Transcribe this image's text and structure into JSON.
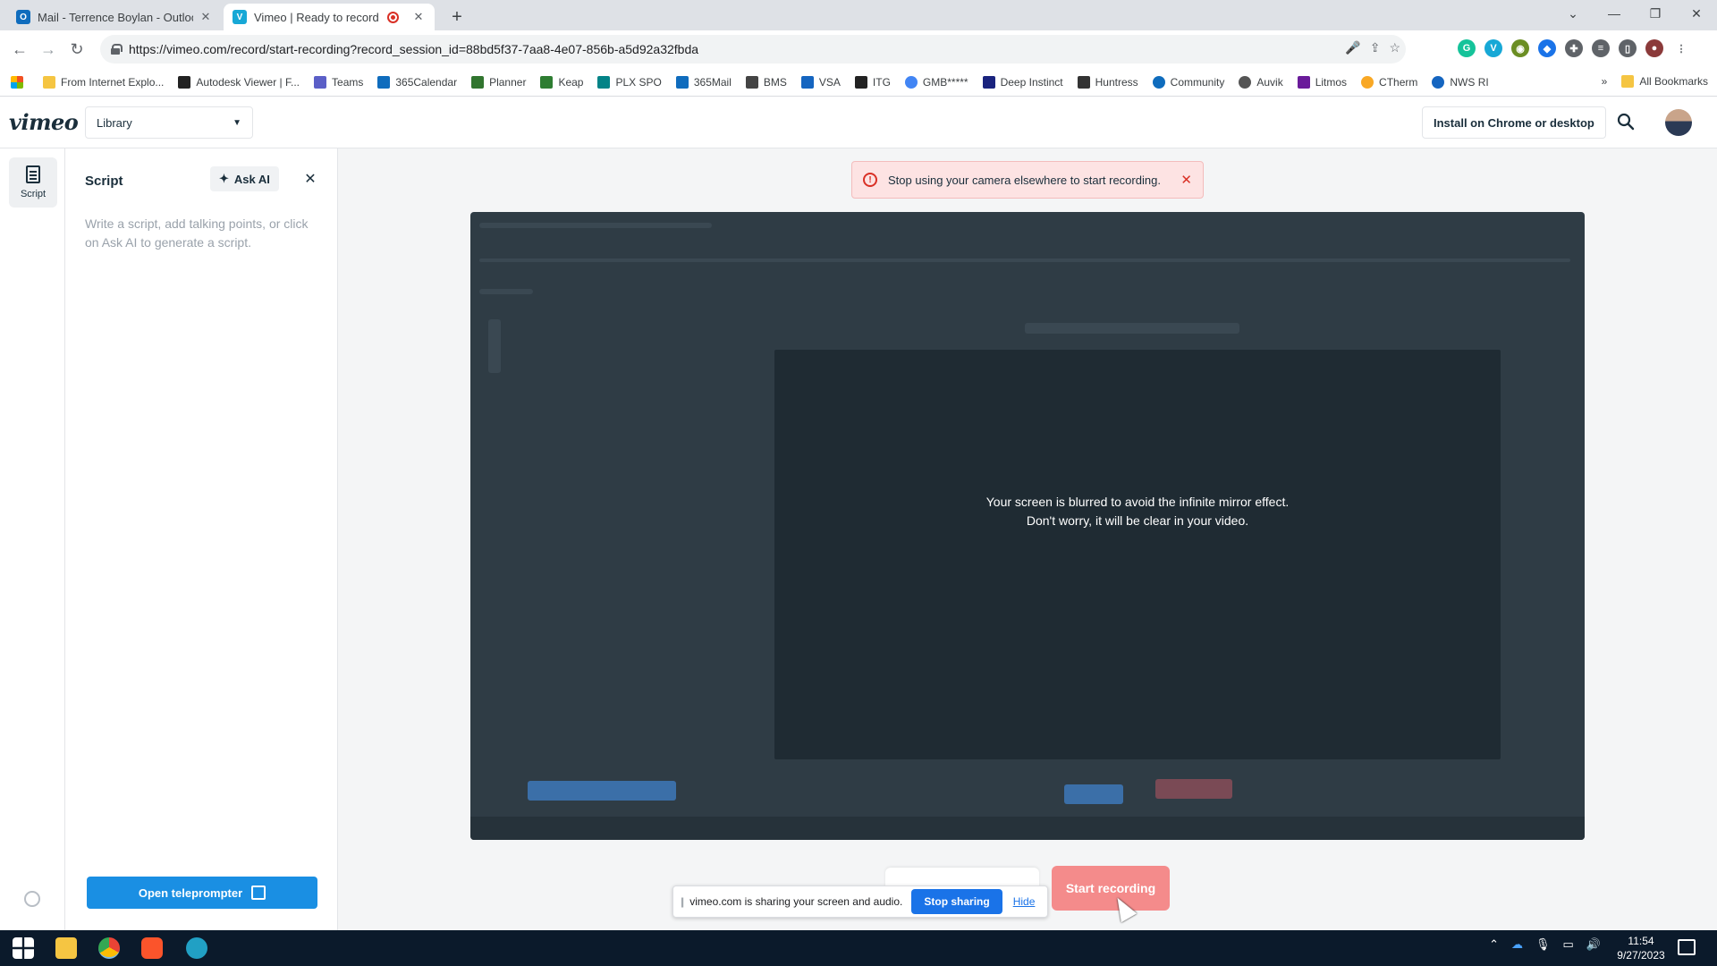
{
  "browser": {
    "tabs": [
      {
        "title": "Mail - Terrence Boylan - Outlook",
        "favicon": "outlook-icon",
        "color": "#0f6cbd"
      },
      {
        "title": "Vimeo | Ready to record",
        "favicon": "vimeo-icon",
        "color": "#17d5ff"
      }
    ],
    "url": "https://vimeo.com/record/start-recording?record_session_id=88bd5f37-7aa8-4e07-856b-a5d92a32fbda",
    "bookmarks": [
      "From Internet Explo...",
      "Autodesk Viewer | F...",
      "Teams",
      "365Calendar",
      "Planner",
      "Keap",
      "PLX SPO",
      "365Mail",
      "BMS",
      "VSA",
      "ITG",
      "GMB*****",
      "Deep Instinct",
      "Huntress",
      "Community",
      "Auvik",
      "Litmos",
      "CTherm",
      "NWS RI"
    ],
    "all_bookmarks": "All Bookmarks",
    "more_bookmarks": "»"
  },
  "header": {
    "logo": "vimeo",
    "library_label": "Library",
    "install_label": "Install on Chrome or desktop"
  },
  "rail": {
    "script_label": "Script"
  },
  "script_panel": {
    "title": "Script",
    "ask_ai_label": "Ask AI",
    "placeholder": "Write a script, add talking points, or click on Ask AI to generate a script.",
    "teleprompter_label": "Open teleprompter"
  },
  "main": {
    "alert_text": "Stop using your camera elsewhere to start recording.",
    "mirror_line1": "Your screen is blurred to avoid the infinite mirror effect.",
    "mirror_line2": "Don't worry, it will be clear in your video.",
    "start_recording_label": "Start recording"
  },
  "share_bar": {
    "message": "vimeo.com is sharing your screen and audio.",
    "stop_label": "Stop sharing",
    "hide_label": "Hide"
  },
  "taskbar": {
    "time": "11:54",
    "date": "9/27/2023"
  },
  "colors": {
    "accent": "#1a8fe3",
    "record": "#f48b8b",
    "alert_bg": "#fde3e3"
  }
}
